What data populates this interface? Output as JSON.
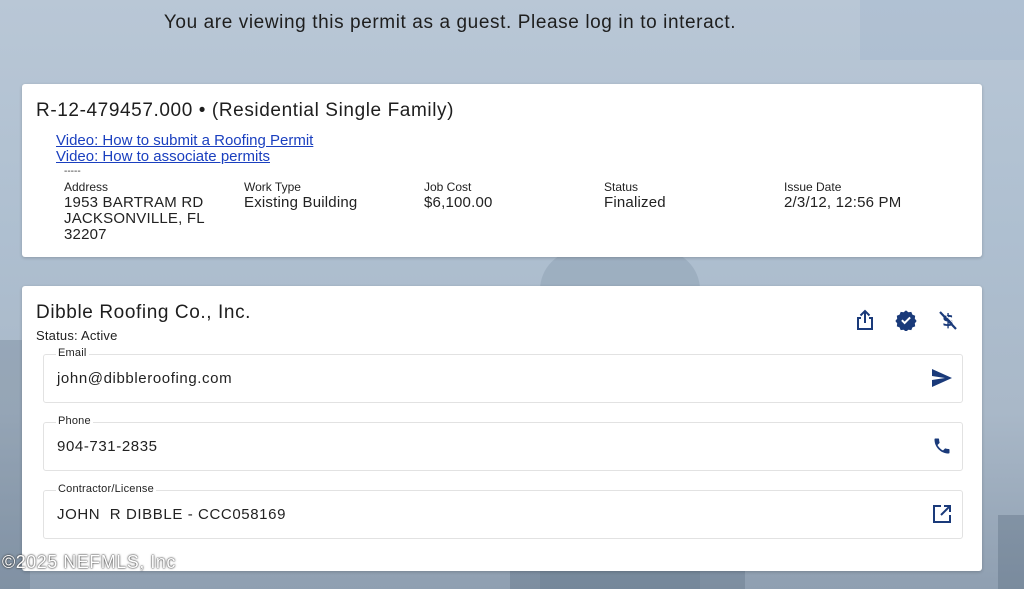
{
  "banner": {
    "guest_message": "You are viewing this permit as a guest. Please log in to interact."
  },
  "permit": {
    "title": "R-12-479457.000 • (Residential Single Family)",
    "links": [
      "Video: How to submit a Roofing Permit",
      "Video: How to associate permits"
    ],
    "separator": "-----",
    "fields": {
      "address": {
        "label": "Address",
        "lines": [
          "1953 BARTRAM RD",
          "JACKSONVILLE, FL",
          "32207"
        ]
      },
      "work_type": {
        "label": "Work Type",
        "value": "Existing Building"
      },
      "job_cost": {
        "label": "Job Cost",
        "value": "$6,100.00"
      },
      "status": {
        "label": "Status",
        "value": "Finalized"
      },
      "issue_date": {
        "label": "Issue Date",
        "value": "2/3/12, 12:56 PM"
      }
    }
  },
  "contractor": {
    "name": "Dibble Roofing Co., Inc.",
    "status": "Status: Active",
    "icons": [
      "share-icon",
      "verified-icon",
      "money-off-icon"
    ],
    "email": {
      "label": "Email",
      "value": "john@dibbleroofing.com",
      "action_icon": "send-icon"
    },
    "phone": {
      "label": "Phone",
      "value": "904-731-2835",
      "action_icon": "phone-icon"
    },
    "license": {
      "label": "Contractor/License",
      "value": "JOHN  R DIBBLE - CCC058169",
      "action_icon": "open-in-new-icon"
    }
  },
  "watermark": {
    "text": "©2025 NEFMLS, Inc"
  },
  "colors": {
    "link": "#1a3fbf",
    "icon": "#1a3a7a",
    "card_bg": "#ffffff"
  }
}
